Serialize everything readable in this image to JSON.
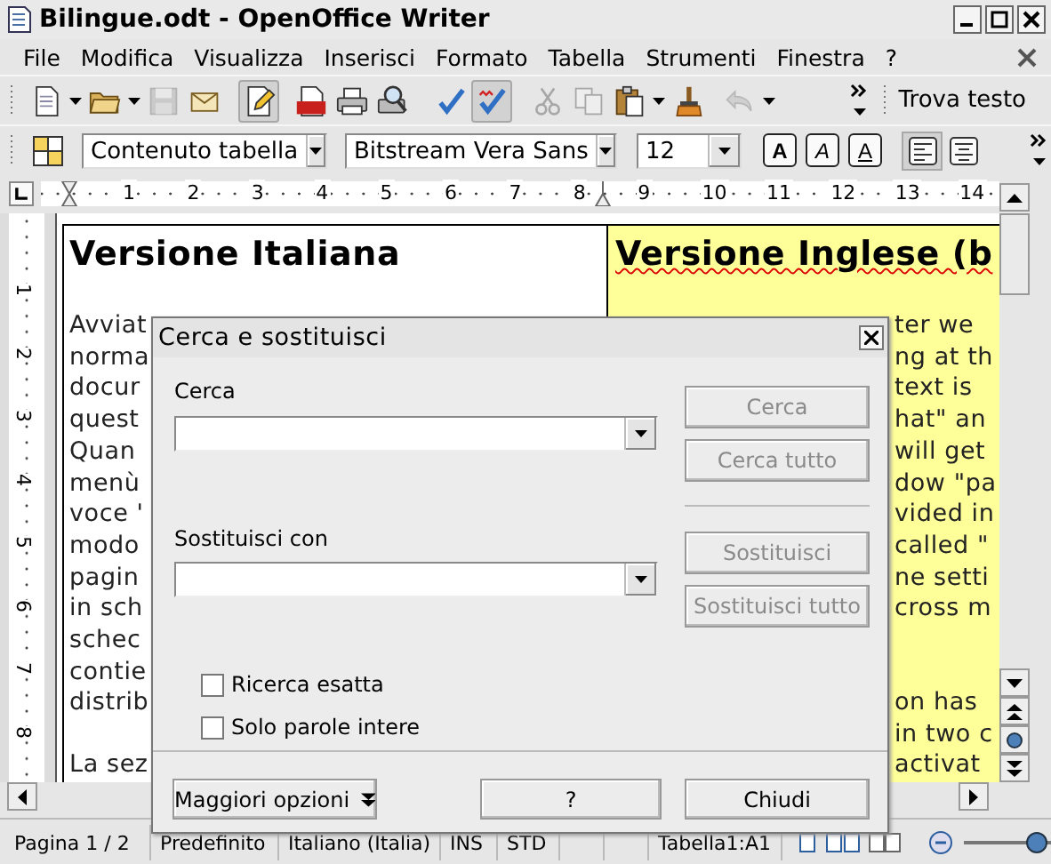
{
  "window": {
    "title": "Bilingue.odt - OpenOffice Writer"
  },
  "menu": [
    "File",
    "Modifica",
    "Visualizza",
    "Inserisci",
    "Formato",
    "Tabella",
    "Strumenti",
    "Finestra",
    "?"
  ],
  "toolbar": [
    {
      "kind": "new",
      "dropdown": true,
      "disabled": false,
      "on": false
    },
    {
      "kind": "open",
      "dropdown": true,
      "disabled": false,
      "on": false
    },
    {
      "kind": "save",
      "dropdown": false,
      "disabled": true,
      "on": false
    },
    {
      "kind": "mail",
      "dropdown": false,
      "disabled": false,
      "on": false
    },
    {
      "kind": "edit",
      "dropdown": false,
      "disabled": false,
      "on": true
    },
    {
      "kind": "pdf",
      "dropdown": false,
      "disabled": false,
      "on": false
    },
    {
      "kind": "print",
      "dropdown": false,
      "disabled": false,
      "on": false
    },
    {
      "kind": "preview",
      "dropdown": false,
      "disabled": false,
      "on": false
    },
    {
      "kind": "spell",
      "dropdown": false,
      "disabled": false,
      "on": false
    },
    {
      "kind": "autospell",
      "dropdown": false,
      "disabled": false,
      "on": true
    },
    {
      "kind": "cut",
      "dropdown": false,
      "disabled": true,
      "on": false
    },
    {
      "kind": "copy",
      "dropdown": false,
      "disabled": true,
      "on": false
    },
    {
      "kind": "paste",
      "dropdown": true,
      "disabled": false,
      "on": false
    },
    {
      "kind": "brush",
      "dropdown": false,
      "disabled": false,
      "on": false
    },
    {
      "kind": "undo",
      "dropdown": true,
      "disabled": true,
      "on": false
    }
  ],
  "find_toolbar": {
    "label": "Trova testo"
  },
  "format_toolbar": {
    "style": "Contenuto tabella",
    "font": "Bitstream Vera Sans",
    "size": "12",
    "buttons": [
      {
        "label": "A",
        "kind": "bold"
      },
      {
        "label": "A",
        "kind": "italic"
      },
      {
        "label": "A",
        "kind": "underline"
      }
    ],
    "align": [
      {
        "kind": "left",
        "on": true
      },
      {
        "kind": "center",
        "on": false
      }
    ]
  },
  "ruler": {
    "marks": [
      "1",
      "2",
      "3",
      "4",
      "5",
      "6",
      "7",
      "8",
      "9",
      "10",
      "11",
      "12",
      "13",
      "14"
    ]
  },
  "vertical_ruler": {
    "marks": [
      "1",
      "2",
      "3",
      "4",
      "5",
      "6",
      "7",
      "8"
    ]
  },
  "document": {
    "columns": [
      {
        "heading": "Versione Italiana",
        "highlighted": false,
        "misspelled": false,
        "paragraphs": [
          [
            "Avviat",
            "norma",
            "docur",
            "quest",
            "Quan",
            "menù",
            "voce '",
            "modo",
            "pagin",
            "in sch",
            "schec",
            "contie",
            "distrib"
          ],
          [
            "La sez"
          ]
        ]
      },
      {
        "heading": "Versione Inglese (b",
        "highlighted": true,
        "misspelled": true,
        "paragraphs": [
          [
            "ter we",
            "ng at th",
            "text is",
            "hat\" an",
            "will get",
            "dow \"pa",
            "vided in",
            "called \"",
            "ne setti",
            "cross m"
          ],
          [
            "on has",
            "in two c",
            "activat"
          ]
        ]
      }
    ]
  },
  "status_bar": [
    "Pagina 1 / 2",
    "Predefinito",
    "Italiano (Italia)",
    "INS",
    "STD",
    "Tabella1:A1"
  ],
  "zoom_slider": {
    "level": 0.95
  },
  "dialog": {
    "title": "Cerca e sostituisci",
    "sections": [
      {
        "label": "Cerca",
        "buttons": [
          {
            "label": "Cerca",
            "disabled": true
          },
          {
            "label": "Cerca tutto",
            "disabled": true
          }
        ]
      },
      {
        "label": "Sostituisci con",
        "buttons": [
          {
            "label": "Sostituisci",
            "disabled": true
          },
          {
            "label": "Sostituisci tutto",
            "disabled": true
          }
        ]
      }
    ],
    "options": [
      {
        "label": "Ricerca esatta",
        "checked": false
      },
      {
        "label": "Solo parole intere",
        "checked": false
      }
    ],
    "footer_buttons": [
      {
        "label": "Maggiori opzioni",
        "kind": "more"
      },
      {
        "label": "?",
        "kind": "help"
      },
      {
        "label": "Chiudi",
        "kind": "close"
      }
    ]
  }
}
